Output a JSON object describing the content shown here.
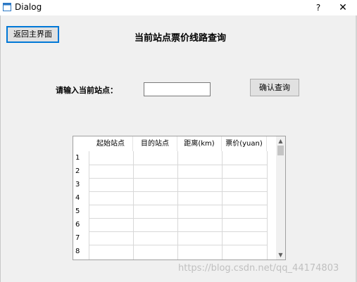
{
  "window": {
    "title": "Dialog",
    "help_label": "?",
    "close_label": "✕"
  },
  "header": {
    "back_button_label": "返回主界面",
    "page_title": "当前站点票价线路查询"
  },
  "query": {
    "station_label": "请输入当前站点：",
    "station_value": "",
    "confirm_button_label": "确认查询"
  },
  "table": {
    "columns": [
      "起始站点",
      "目的站点",
      "距离(km)",
      "票价(yuan)"
    ],
    "row_numbers": [
      "1",
      "2",
      "3",
      "4",
      "5",
      "6",
      "7",
      "8"
    ]
  },
  "scrollbar": {
    "up_glyph": "▲",
    "down_glyph": "▼"
  },
  "watermark": "https://blog.csdn.net/qq_44174803",
  "colors": {
    "window_bg": "#f0f0f0",
    "focus_border": "#0078d7"
  }
}
